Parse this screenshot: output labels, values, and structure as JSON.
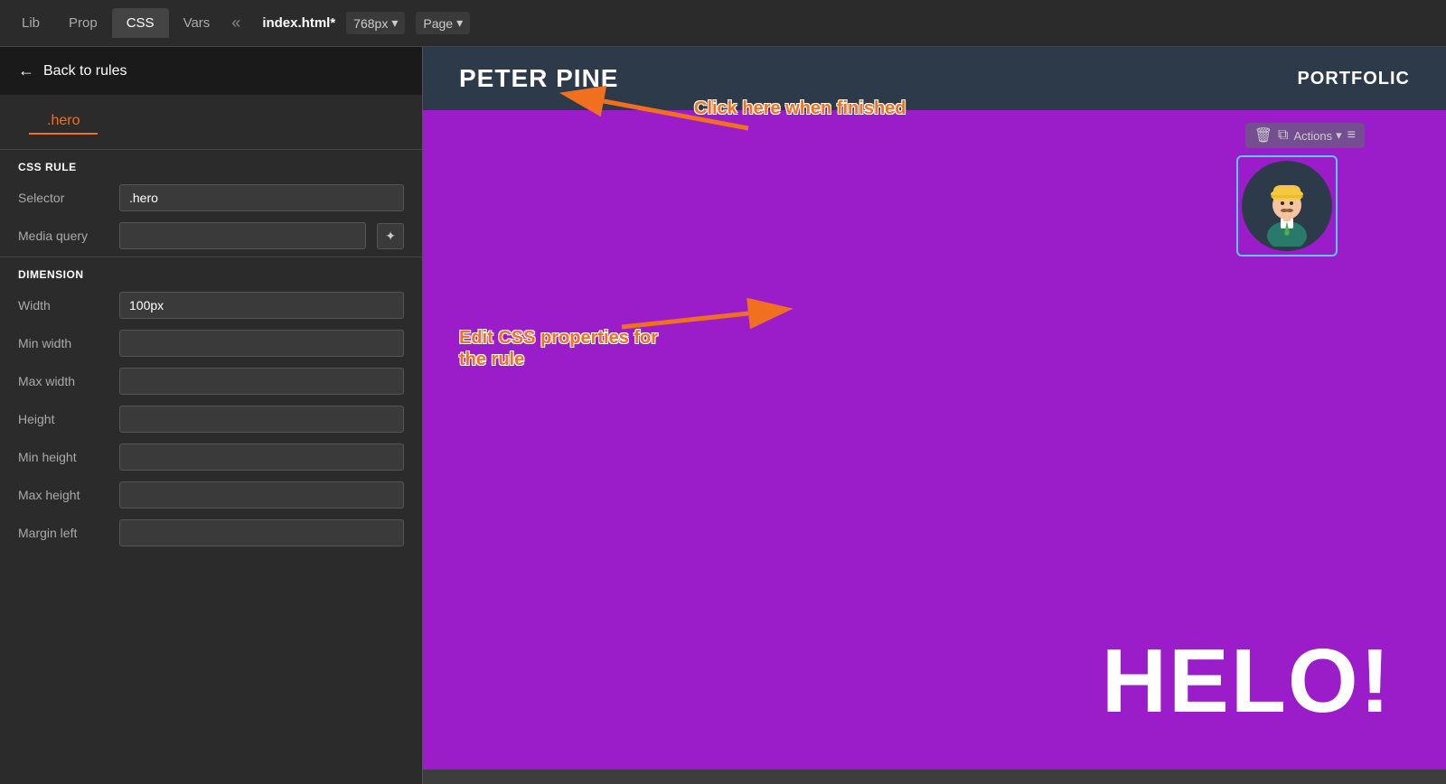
{
  "tabs": {
    "lib": "Lib",
    "prop": "Prop",
    "css": "CSS",
    "vars": "Vars",
    "active": "css"
  },
  "collapse_icon": "«",
  "sidebar": {
    "back_label": "Back to rules",
    "selector_value": ".hero",
    "sections": {
      "css_rule": {
        "header": "CSS RULE",
        "selector_label": "Selector",
        "selector_value": ".hero",
        "media_query_label": "Media query",
        "media_query_value": "",
        "media_query_placeholder": "",
        "wand_icon": "✦"
      },
      "dimension": {
        "header": "DIMENSION",
        "width_label": "Width",
        "width_value": "100px",
        "min_width_label": "Min width",
        "min_width_value": "",
        "max_width_label": "Max width",
        "max_width_value": "",
        "height_label": "Height",
        "height_value": "",
        "min_height_label": "Min height",
        "min_height_value": "",
        "max_height_label": "Max height",
        "max_height_value": "",
        "margin_left_label": "Margin left",
        "margin_left_value": ""
      }
    }
  },
  "preview": {
    "file_name": "index.html*",
    "viewport": "768px",
    "page": "Page",
    "nav_title": "PETER PINE",
    "nav_portfolio": "PORTFOLIC",
    "hero_text": "HELO!",
    "actions_label": "Actions",
    "colors": {
      "nav_bg": "#2d3a4a",
      "hero_bg": "#9b1cc9",
      "avatar_bg": "#2d3a4a",
      "selection_border": "#5bc8f5"
    }
  },
  "annotations": {
    "click_here": "Click here when finished",
    "edit_css": "Edit CSS properties for\nthe rule"
  }
}
